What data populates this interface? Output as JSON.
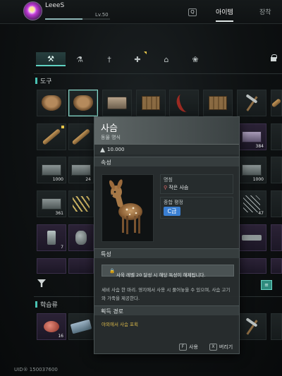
{
  "player": {
    "name": "LeeeS",
    "level": "Lv.50",
    "uid": "UID® 150037600"
  },
  "header": {
    "search_key": "Q",
    "tab_items": "아이템",
    "tab_equipment": "장착"
  },
  "categories": [
    {
      "icon": "tool-icon",
      "glyph": "⚒",
      "active": true
    },
    {
      "icon": "bottle-icon",
      "glyph": "⚗",
      "active": false
    },
    {
      "icon": "torch-icon",
      "glyph": "†",
      "active": false
    },
    {
      "icon": "medkit-icon",
      "glyph": "✚",
      "active": false,
      "new": true
    },
    {
      "icon": "house-icon",
      "glyph": "⌂",
      "active": false
    },
    {
      "icon": "butterfly-icon",
      "glyph": "❀",
      "active": false
    }
  ],
  "sections": {
    "tools": "도구",
    "learning": "학습류"
  },
  "counts": {
    "c1000a": "1000",
    "c24": "24",
    "c361": "361",
    "c7": "7",
    "c384": "384",
    "c1000b": "1000",
    "c47": "47",
    "c16": "16"
  },
  "tooltip": {
    "name": "사슴",
    "type": "동물 명식",
    "price": "10.000",
    "section_attributes": "속성",
    "name_label": "명칭",
    "name_value": "작은 사슴",
    "grade_label": "종합 평정",
    "grade_value": "C급",
    "section_traits": "특성",
    "trait_text": "사육 레벨 20 달성 시 해당 특성이 해제됩니다.",
    "description": "세비 사슴 한 마리. 영지에서 사용 시 풀어놓을 수 있으며, 사슴 고기와 가죽을 제공한다.",
    "section_route": "획득 경로",
    "route_text": "야외에서 사슴 포획",
    "use_key": "F",
    "use_label": "사용",
    "discard_key": "X",
    "discard_label": "버리기"
  },
  "colors": {
    "accent": "#49c2b3",
    "grade_c": "#3a7fd2",
    "route": "#d8b74a"
  }
}
